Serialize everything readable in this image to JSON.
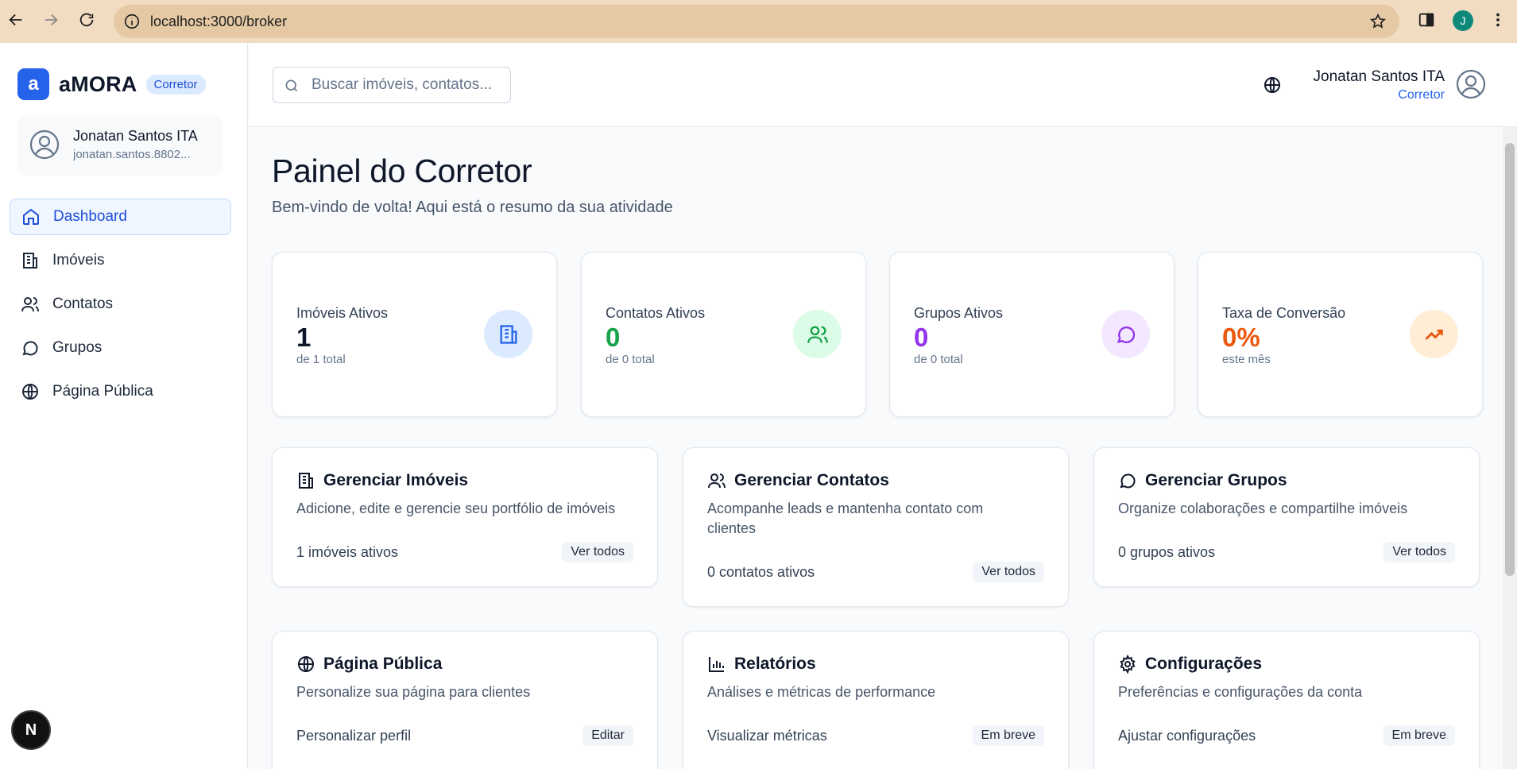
{
  "browser": {
    "url": "localhost:3000/broker",
    "profile_initial": "J"
  },
  "sidebar": {
    "logo_letter": "a",
    "brand": "aMORA",
    "role_badge": "Corretor",
    "user": {
      "name": "Jonatan Santos ITA",
      "email": "jonatan.santos.8802..."
    },
    "items": [
      {
        "label": "Dashboard",
        "icon": "home-icon",
        "active": true
      },
      {
        "label": "Imóveis",
        "icon": "building-icon"
      },
      {
        "label": "Contatos",
        "icon": "users-icon"
      },
      {
        "label": "Grupos",
        "icon": "chat-icon"
      },
      {
        "label": "Página Pública",
        "icon": "globe-icon"
      }
    ],
    "dev_badge": "N"
  },
  "header": {
    "search_placeholder": "Buscar imóveis, contatos...",
    "user_name": "Jonatan Santos ITA",
    "user_role": "Corretor"
  },
  "main": {
    "title": "Painel do Corretor",
    "subtitle": "Bem-vindo de volta! Aqui está o resumo da sua atividade",
    "stats": [
      {
        "label": "Imóveis Ativos",
        "value": "1",
        "sub": "de 1 total",
        "color": "#0f172a",
        "icon_bg": "#dbeafe",
        "icon_color": "#2563eb",
        "icon": "building-icon"
      },
      {
        "label": "Contatos Ativos",
        "value": "0",
        "sub": "de 0 total",
        "color": "#16a34a",
        "icon_bg": "#dcfce7",
        "icon_color": "#16a34a",
        "icon": "users-icon"
      },
      {
        "label": "Grupos Ativos",
        "value": "0",
        "sub": "de 0 total",
        "color": "#9333ea",
        "icon_bg": "#f3e8ff",
        "icon_color": "#9333ea",
        "icon": "chat-icon"
      },
      {
        "label": "Taxa de Conversão",
        "value": "0%",
        "sub": "este mês",
        "color": "#ea580c",
        "icon_bg": "#ffedd5",
        "icon_color": "#ea580c",
        "icon": "trending-up-icon"
      }
    ],
    "cards": [
      {
        "title": "Gerenciar Imóveis",
        "desc": "Adicione, edite e gerencie seu portfólio de imóveis",
        "footer": "1 imóveis ativos",
        "button": "Ver todos",
        "icon": "building-icon"
      },
      {
        "title": "Gerenciar Contatos",
        "desc": "Acompanhe leads e mantenha contato com clientes",
        "footer": "0 contatos ativos",
        "button": "Ver todos",
        "icon": "users-icon"
      },
      {
        "title": "Gerenciar Grupos",
        "desc": "Organize colaborações e compartilhe imóveis",
        "footer": "0 grupos ativos",
        "button": "Ver todos",
        "icon": "chat-icon"
      },
      {
        "title": "Página Pública",
        "desc": "Personalize sua página para clientes",
        "footer": "Personalizar perfil",
        "button": "Editar",
        "icon": "globe-icon"
      },
      {
        "title": "Relatórios",
        "desc": "Análises e métricas de performance",
        "footer": "Visualizar métricas",
        "button": "Em breve",
        "icon": "bar-chart-icon"
      },
      {
        "title": "Configurações",
        "desc": "Preferências e configurações da conta",
        "footer": "Ajustar configurações",
        "button": "Em breve",
        "icon": "gear-icon"
      }
    ]
  }
}
